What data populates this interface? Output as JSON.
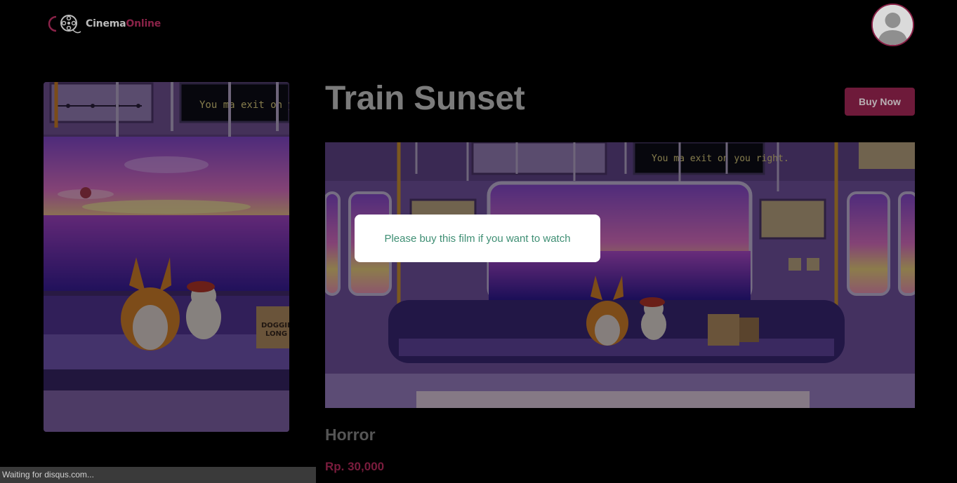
{
  "brand": {
    "name_part1": "Cinema",
    "name_part2": "Online"
  },
  "header": {
    "avatar_icon": "user-icon"
  },
  "movie": {
    "title": "Train Sunset",
    "buy_label": "Buy Now",
    "genre": "Horror",
    "price": "Rp. 30,000",
    "poster_sign_text": "You ma exit on you right.",
    "bag_text_1": "DOGGIE",
    "bag_text_2": "LONG"
  },
  "modal": {
    "message": "Please buy this film if you want to watch"
  },
  "status_bar": {
    "text": "Waiting for disqus.com..."
  },
  "colors": {
    "accent": "#8a2248",
    "background": "#000000",
    "modal_text": "#3f8f74"
  }
}
